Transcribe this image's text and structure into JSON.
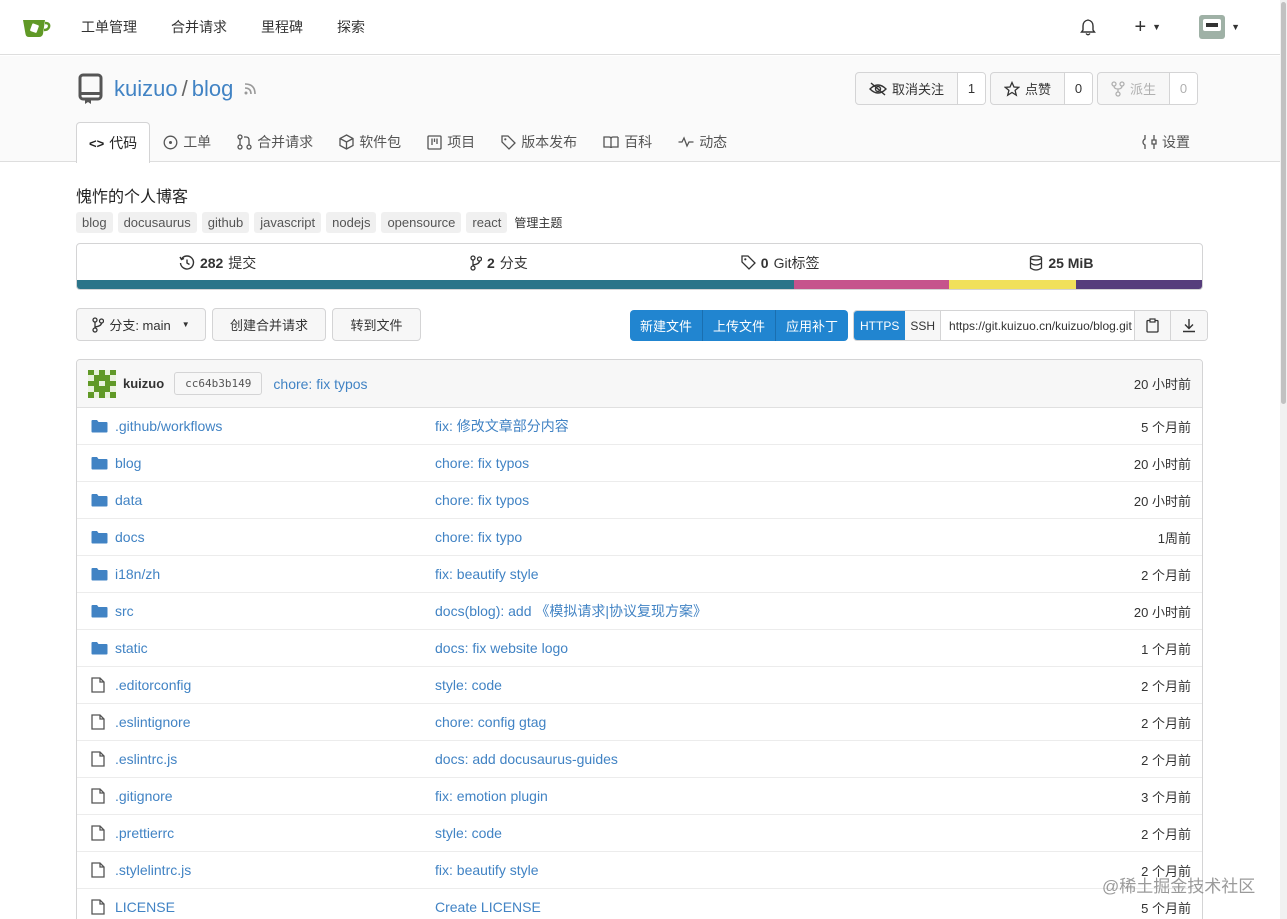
{
  "nav": {
    "items": [
      "工单管理",
      "合并请求",
      "里程碑",
      "探索"
    ]
  },
  "repo": {
    "owner": "kuizuo",
    "separator": "/",
    "name": "blog",
    "actions": {
      "watch": {
        "label": "取消关注",
        "count": "1"
      },
      "star": {
        "label": "点赞",
        "count": "0"
      },
      "fork": {
        "label": "派生",
        "count": "0"
      }
    },
    "tabs": [
      "代码",
      "工单",
      "合并请求",
      "软件包",
      "项目",
      "版本发布",
      "百科",
      "动态"
    ],
    "settings_label": "设置",
    "description": "愧怍的个人博客",
    "topics": [
      "blog",
      "docusaurus",
      "github",
      "javascript",
      "nodejs",
      "opensource",
      "react"
    ],
    "manage_topics_label": "管理主题"
  },
  "stats": {
    "commits": {
      "value": "282",
      "label": "提交"
    },
    "branches": {
      "value": "2",
      "label": "分支"
    },
    "tags": {
      "value": "0",
      "label": "Git标签"
    },
    "size": {
      "value": "25 MiB"
    }
  },
  "language_bar": [
    {
      "color": "#2b7489",
      "percent": 63.7
    },
    {
      "color": "#c6538c",
      "percent": 13.8
    },
    {
      "color": "#f1e05a",
      "percent": 11.3
    },
    {
      "color": "#563d7c",
      "percent": 11.2
    }
  ],
  "toolbar": {
    "branch_label": "分支: main",
    "new_pr_label": "创建合并请求",
    "goto_file_label": "转到文件",
    "new_file_label": "新建文件",
    "upload_file_label": "上传文件",
    "apply_patch_label": "应用补丁",
    "https_label": "HTTPS",
    "ssh_label": "SSH",
    "clone_url": "https://git.kuizuo.cn/kuizuo/blog.git"
  },
  "latest_commit": {
    "author": "kuizuo",
    "sha": "cc64b3b149",
    "message": "chore: fix typos",
    "time": "20 小时前"
  },
  "files": [
    {
      "type": "folder",
      "name": ".github/workflows",
      "message": "fix: 修改文章部分内容",
      "time": "5 个月前"
    },
    {
      "type": "folder",
      "name": "blog",
      "message": "chore: fix typos",
      "time": "20 小时前"
    },
    {
      "type": "folder",
      "name": "data",
      "message": "chore: fix typos",
      "time": "20 小时前"
    },
    {
      "type": "folder",
      "name": "docs",
      "message": "chore: fix typo",
      "time": "1周前"
    },
    {
      "type": "folder",
      "name": "i18n/zh",
      "message": "fix: beautify style",
      "time": "2 个月前"
    },
    {
      "type": "folder",
      "name": "src",
      "message": "docs(blog): add 《模拟请求|协议复现方案》",
      "time": "20 小时前"
    },
    {
      "type": "folder",
      "name": "static",
      "message": "docs: fix website logo",
      "time": "1 个月前"
    },
    {
      "type": "file",
      "name": ".editorconfig",
      "message": "style: code",
      "time": "2 个月前"
    },
    {
      "type": "file",
      "name": ".eslintignore",
      "message": "chore: config gtag",
      "time": "2 个月前"
    },
    {
      "type": "file",
      "name": ".eslintrc.js",
      "message": "docs: add docusaurus-guides",
      "time": "2 个月前"
    },
    {
      "type": "file",
      "name": ".gitignore",
      "message": "fix: emotion plugin",
      "time": "3 个月前"
    },
    {
      "type": "file",
      "name": ".prettierrc",
      "message": "style: code",
      "time": "2 个月前"
    },
    {
      "type": "file",
      "name": ".stylelintrc.js",
      "message": "fix: beautify style",
      "time": "2 个月前"
    },
    {
      "type": "file",
      "name": "LICENSE",
      "message": "Create LICENSE",
      "time": "5 个月前"
    }
  ],
  "watermark": "@稀土掘金技术社区",
  "colors": {
    "link": "#4183c4",
    "primary_button": "#2185d0",
    "folder_icon": "#4183c4",
    "logo": "#609926"
  }
}
